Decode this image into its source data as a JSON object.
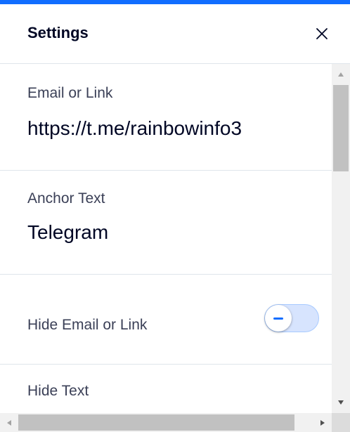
{
  "header": {
    "title": "Settings",
    "close_icon": "close-icon"
  },
  "fields": {
    "email_or_link": {
      "label": "Email or Link",
      "value": "https://t.me/rainbowinfo3"
    },
    "anchor_text": {
      "label": "Anchor Text",
      "value": "Telegram"
    },
    "hide_email_or_link": {
      "label": "Hide Email or Link",
      "toggle_on": false
    },
    "hide_text": {
      "label": "Hide Text"
    }
  },
  "colors": {
    "accent": "#116dff",
    "toggle_track": "#d7e4fe",
    "title_text": "#000624",
    "label_text": "#3b4057",
    "divider": "#dfe5eb"
  }
}
